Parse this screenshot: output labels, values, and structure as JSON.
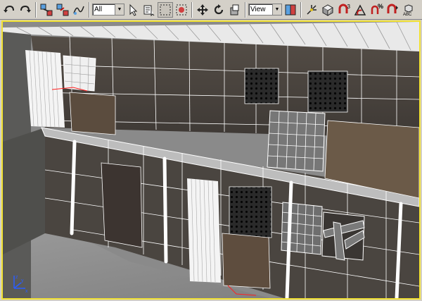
{
  "toolbar": {
    "buttons": [
      {
        "name": "undo-icon"
      },
      {
        "name": "redo-icon"
      },
      {
        "name": "select-and-link-icon"
      },
      {
        "name": "unlink-selection-icon"
      },
      {
        "name": "bind-to-space-warp-icon"
      }
    ],
    "selection_filter": "All",
    "tools": [
      {
        "name": "select-object-icon"
      },
      {
        "name": "select-by-name-icon"
      },
      {
        "name": "rectangular-selection-region-icon"
      },
      {
        "name": "window-crossing-icon"
      },
      {
        "name": "select-and-move-icon"
      },
      {
        "name": "select-and-rotate-icon"
      },
      {
        "name": "select-and-scale-icon"
      }
    ],
    "reference_coordinate": "View",
    "right_tools": [
      {
        "name": "use-pivot-center-icon"
      },
      {
        "name": "select-and-manipulate-icon"
      },
      {
        "name": "keyboard-shortcut-override-icon"
      },
      {
        "name": "snaps-toggle-icon",
        "label": "3"
      },
      {
        "name": "angle-snap-icon"
      },
      {
        "name": "percent-snap-icon",
        "label": "%"
      },
      {
        "name": "spinner-snap-icon"
      },
      {
        "name": "edit-named-selection-icon",
        "label": "ABC"
      }
    ]
  },
  "viewport": {
    "border_color": "#f2e233",
    "wireframe_color": "#ffffff",
    "wall_color": "#4a4540",
    "floor_color": "#8c8c8c"
  }
}
